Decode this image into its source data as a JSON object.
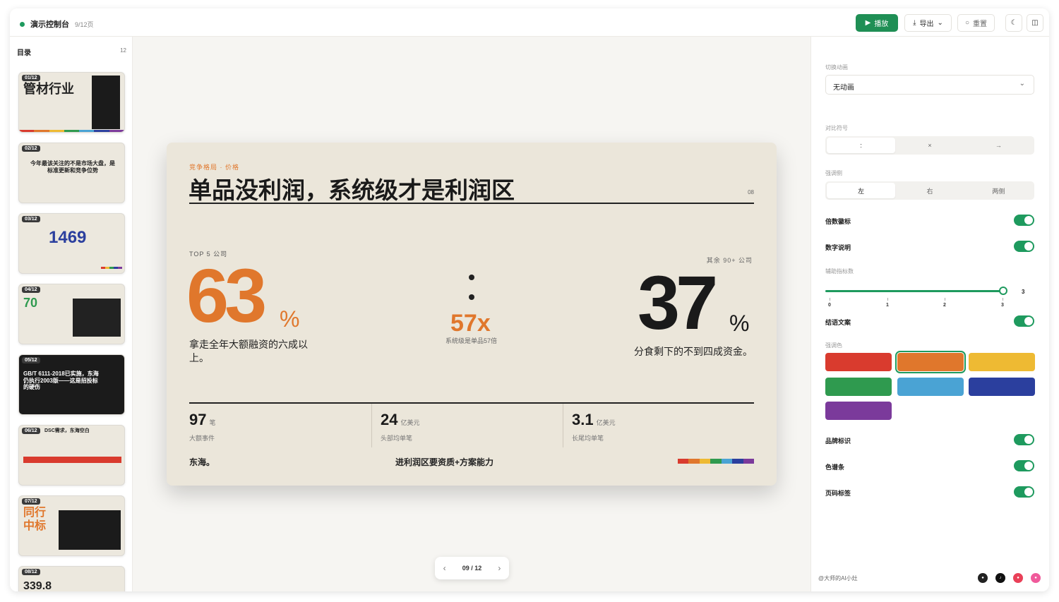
{
  "app": {
    "title": "演示控制台",
    "page_indicator": "9/12页"
  },
  "toolbar": {
    "play": "播放",
    "export": "导出",
    "reset": "重置"
  },
  "sidebar": {
    "heading": "目录",
    "count": "12",
    "thumbs": [
      {
        "badge": "01/12",
        "title": "管材行业"
      },
      {
        "badge": "02/12",
        "title": "今年最该关注的不是市场大盘，是标准更新和竞争位势"
      },
      {
        "badge": "03/12",
        "title": "1469"
      },
      {
        "badge": "04/12",
        "title": "70"
      },
      {
        "badge": "05/12",
        "title": "GB/T 6111-2018已实施，东海仍执行2003版——这是招投标的硬伤"
      },
      {
        "badge": "06/12",
        "title": "DSC需求，东海空白"
      },
      {
        "badge": "07/12",
        "title": "同行中标"
      },
      {
        "badge": "08/12",
        "title": "339.8"
      }
    ]
  },
  "slide": {
    "kicker": "竞争格局 · 价格",
    "title": "单品没利润，系统级才是利润区",
    "page_num": "08",
    "left_label": "TOP 5 公司",
    "left_value": "63",
    "left_unit": "%",
    "left_desc": "拿走全年大额融资的六成以上。",
    "mid_value": "57x",
    "mid_desc": "系统级是单品57倍",
    "right_label": "其余 90+ 公司",
    "right_value": "37",
    "right_unit": "%",
    "right_desc": "分食剩下的不到四成资金。",
    "stats": [
      {
        "value": "97",
        "unit": "笔",
        "desc": "大额事件"
      },
      {
        "value": "24",
        "unit": "亿美元",
        "desc": "头部均单笔"
      },
      {
        "value": "3.1",
        "unit": "亿美元",
        "desc": "长尾均单笔"
      }
    ],
    "footer_brand": "东海。",
    "footer_text": "进利润区要资质+方案能力"
  },
  "pager": {
    "current": "09",
    "sep": "/",
    "total": "12"
  },
  "settings": {
    "transition_label": "切换动画",
    "transition_value": "无动画",
    "compare_label": "对比符号",
    "compare_options": [
      ":",
      "×",
      "→"
    ],
    "emphasis_label": "强调侧",
    "emphasis_options": [
      "左",
      "右",
      "两侧"
    ],
    "multiplier_badge": "倍数徽标",
    "number_note": "数字说明",
    "aux_label": "辅助指标数",
    "aux_value": "3",
    "aux_ticks": [
      "0",
      "1",
      "2",
      "3"
    ],
    "closing_text": "结语文案",
    "accent_label": "强调色",
    "brand_mark": "品牌标识",
    "color_bar": "色谱条",
    "page_tag": "页码标签",
    "credit": "@大师的AI小灶"
  },
  "colors": {
    "accent": "#e0772c",
    "green": "#1e9a5e",
    "swatches": [
      "#d93b2e",
      "#e0772c",
      "#eeba33",
      "#2f9a4f",
      "#4aa3d4",
      "#2b3f9e",
      "#7b3a9b"
    ],
    "spectrum": [
      "#d93b2e",
      "#e0772c",
      "#eeba33",
      "#2f9a4f",
      "#4aa3d4",
      "#2b3f9e",
      "#7b3a9b"
    ]
  },
  "icons": [
    "play-icon",
    "download-icon",
    "chevron-down-icon",
    "reset-icon",
    "moon-icon",
    "panel-icon",
    "chevron-left-icon",
    "chevron-right-icon",
    "github-icon",
    "tiktok-icon",
    "xiaohongshu-icon",
    "bilibili-icon"
  ]
}
